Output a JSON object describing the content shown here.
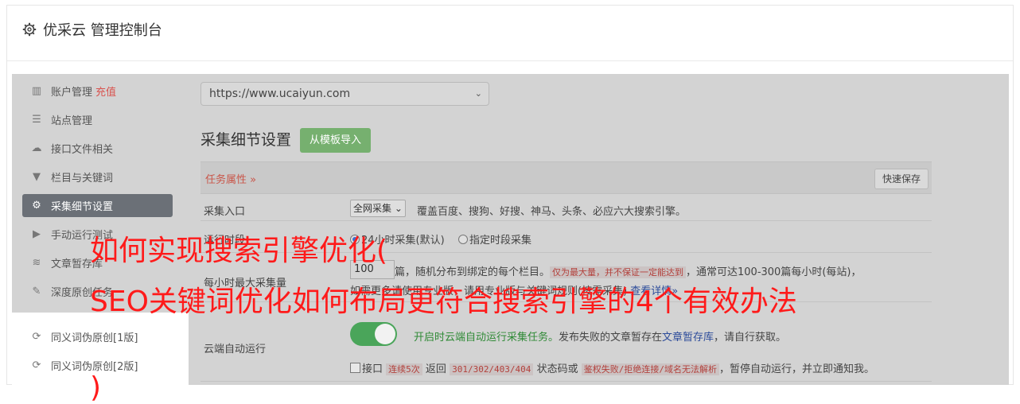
{
  "header": {
    "title": "优采云 管理控制台",
    "icon": "gear-icon"
  },
  "sidebar": {
    "items": [
      {
        "label": "账户管理",
        "extra": "充值",
        "icon": "bar-chart-icon"
      },
      {
        "label": "站点管理",
        "icon": "server-icon"
      },
      {
        "label": "接口文件相关",
        "icon": "cloud-upload-icon"
      },
      {
        "label": "栏目与关键词",
        "icon": "filter-icon"
      },
      {
        "label": "采集细节设置",
        "icon": "gears-icon",
        "active": true
      },
      {
        "label": "手动运行测试",
        "icon": "play-icon"
      },
      {
        "label": "文章暂存库",
        "icon": "database-icon"
      },
      {
        "label": "深度原创任务",
        "icon": "edit-icon"
      },
      {
        "label": "同义词伪原创[1版]",
        "icon": "refresh-icon"
      },
      {
        "label": "同义词伪原创[2版]",
        "icon": "refresh-icon"
      }
    ]
  },
  "main": {
    "site_select": "https://www.ucaiyun.com",
    "section_title": "采集细节设置",
    "import_button": "从模板导入",
    "task_attr": "任务属性 »",
    "quick_save": "快速保存",
    "rows": {
      "entry_label": "采集入口",
      "entry_select": "全网采集",
      "entry_desc": "覆盖百度、搜狗、好搜、神马、头条、必应六大搜索引擎。",
      "time_label": "运行时段",
      "time_opt1": "24小时采集(默认)",
      "time_opt2": "指定时段采集",
      "hourly_label": "每小时最大采集量",
      "hourly_value": "100",
      "hourly_desc1": "篇，随机分布到绑定的每个栏目。",
      "hourly_note": "仅为最大量，并不保证一定能达到",
      "hourly_desc2": "，通常可达100-300篇每小时(每站)，",
      "hourly_desc3": "如需更多请使用专业版，请用专业版与关键词规则(按需采集)",
      "hourly_link": "查看详情»",
      "cloud_label": "云端自动运行",
      "cloud_desc_green": "开启时云端自动运行采集任务。",
      "cloud_desc": "发布失败的文章暂存在",
      "cloud_link": "文章暂存库",
      "cloud_desc_end": "，请自行获取。",
      "iface_prefix": "接口",
      "iface_code1": "连续5次",
      "iface_t1": "返回",
      "iface_code2": "301/302/403/404",
      "iface_t2": "状态码或",
      "iface_code3": "鉴权失败/拒绝连接/域名无法解析",
      "iface_t3": "，暂停自动运行，并立即通知我。"
    }
  },
  "overlay": {
    "line1": "如何实现搜索引擎优化(",
    "line2": "SEO关键词优化如何布局更符合搜索引擎的4个有效办法",
    "line3": ")"
  }
}
